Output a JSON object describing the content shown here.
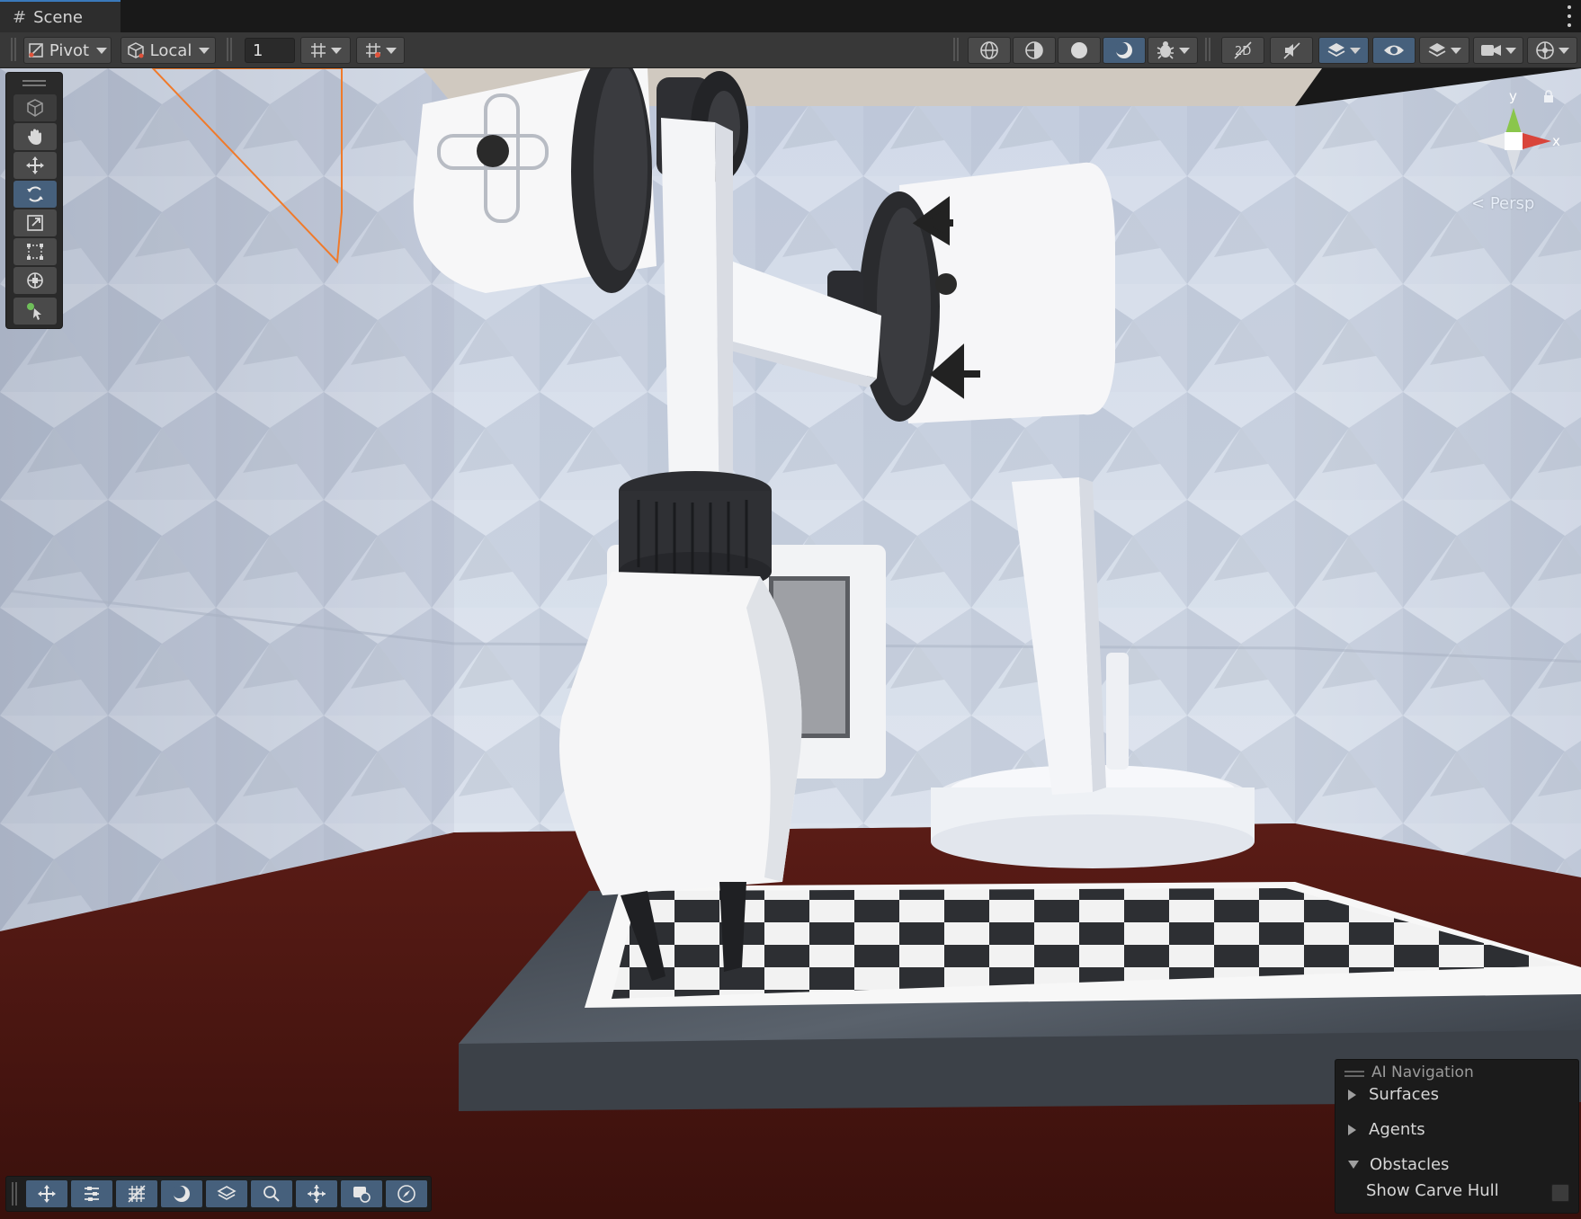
{
  "window": {
    "tab_title": "Scene",
    "tab_icon": "hash-icon"
  },
  "toolbar": {
    "pivot_label": "Pivot",
    "space_label": "Local",
    "snap_increment": "1"
  },
  "viewport": {
    "camera_mode": "Persp",
    "gizmo_axis_y": "y",
    "gizmo_axis_x": "x"
  },
  "left_tools": [
    "view-tool-icon",
    "hand-tool-icon",
    "move-tool-icon",
    "rotate-tool-icon",
    "scale-tool-icon",
    "rect-tool-icon",
    "transform-tool-icon",
    "custom-tool-icon"
  ],
  "bottom_tools": [
    "move-icon",
    "adjust-icon",
    "grid-icon",
    "shading-icon",
    "layers-icon",
    "search-icon",
    "pivot-icon",
    "camera-icon",
    "compass-icon"
  ],
  "ai_navigation": {
    "title": "AI Navigation",
    "items": [
      {
        "label": "Surfaces",
        "expanded": false
      },
      {
        "label": "Agents",
        "expanded": false
      },
      {
        "label": "Obstacles",
        "expanded": true
      }
    ],
    "show_carve_hull_label": "Show Carve Hull",
    "show_carve_hull_checked": false
  },
  "colors": {
    "accent": "#46607c",
    "tab_highlight": "#3a79bb",
    "panel_bg": "#383838",
    "selection_outline": "#f07a2a"
  }
}
